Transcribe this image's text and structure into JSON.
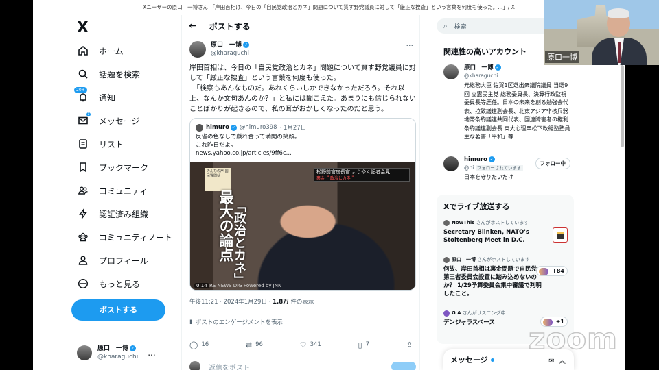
{
  "window": {
    "title": "Xユーザーの原口　一博さん:「岸田首相は、今日の「自民党政治とカネ」問題について質す野党議員に対して「厳正な捜査」という言葉を何度も使った。...」/ X"
  },
  "nav": {
    "logo": "X",
    "items": [
      {
        "label": "ホーム",
        "icon": "home-icon"
      },
      {
        "label": "話題を検索",
        "icon": "search-icon"
      },
      {
        "label": "通知",
        "icon": "bell-icon",
        "badge": "20+"
      },
      {
        "label": "メッセージ",
        "icon": "envelope-icon",
        "badge": "1"
      },
      {
        "label": "リスト",
        "icon": "list-icon"
      },
      {
        "label": "ブックマーク",
        "icon": "bookmark-icon"
      },
      {
        "label": "コミュニティ",
        "icon": "people-icon"
      },
      {
        "label": "認証済み組織",
        "icon": "lightning-icon"
      },
      {
        "label": "コミュニティノート",
        "icon": "community-notes-icon"
      },
      {
        "label": "プロフィール",
        "icon": "person-icon"
      },
      {
        "label": "もっと見る",
        "icon": "more-circle-icon"
      }
    ],
    "post_button": "ポストする",
    "account": {
      "name": "原口　一博",
      "handle": "@kharaguchi",
      "more": "..."
    }
  },
  "main": {
    "header": {
      "back": "←",
      "title": "ポストする"
    },
    "post": {
      "author_name": "原口　一博",
      "author_handle": "@kharaguchi",
      "more": "···",
      "text_lines": [
        "岸田首相は、今日の「自民党政治とカネ」問題について質す野党議員に対",
        "して「厳正な捜査」という言葉を何度も使った。",
        "　「検察もあんなものだ。あれくらいしかできなかっただろう。それ以",
        "上、なんか文句あんのか？」と私には聞こえた。あまりにも信じられない",
        "ことばかりが起きるので、私の耳がおかしくなったのだと思う。"
      ],
      "quote": {
        "name": "himuro",
        "handle": "@himuro398",
        "date": "· 1月27日",
        "lines": [
          "反省の色なしで戯れ合って満開の笑顔。",
          "これ昨日だよ。",
          "news.yahoo.co.jp/articles/9ff6c..."
        ],
        "video": {
          "banner": "みんなの声 国民質問状",
          "title_big": "最大の論点",
          "title_small": "「政治とカネ」",
          "newsbox_main": "松野前官房長官 ようやく記者会見",
          "newsbox_sub": "裏金 ＂政治とカネ＂",
          "caption": "RS NEWS DIG Powered by JNN",
          "duration": "0:14"
        }
      },
      "time": "午後11:21 · 2024年1月29日 · ",
      "views_count": "1.8万",
      "views_label": " 件の表示",
      "engagement": "ポストのエンゲージメントを表示",
      "actions": {
        "reply": "16",
        "repost": "96",
        "like": "341",
        "bookmark": "7"
      }
    },
    "reply_placeholder": "返信をポスト"
  },
  "right": {
    "search_placeholder": "検索",
    "related": {
      "title": "関連性の高いアカウント",
      "accounts": [
        {
          "name": "原口　一博",
          "handle": "@kharaguchi",
          "bio": "元総務大臣 佐賀1区選出衆議院議員 当選9回 立憲民主党 総務委員長、決算行政監視委員長等歴任。日本の未来を創る勉強会代表、拉致議連副会長、北東アジア非核兵器地帯条約議連共同代表、国連障害者の権利条約議連副会長 東大心理卒松下政経塾塾員　主な著書「平和」等"
        },
        {
          "name": "himuro",
          "handle": "@hi",
          "follows_you": "フォローされています",
          "follow_button": "フォロー中",
          "bio": "日本を守りたいだけ"
        }
      ]
    },
    "live": {
      "title": "Xでライブ放送する",
      "items": [
        {
          "host": "NowThis",
          "host_suffix": "さんがホストしています",
          "title": "Secretary Blinken, NATO's Stoltenberg Meet in D.C."
        },
        {
          "host": "原口　一博",
          "host_suffix": "さんがホストしています",
          "title": "何故、岸田首相は裏金問題で自民党の第三者委員会設置に踏み込めないのか？ 1/29予算委員会集中審議で判明したこと。",
          "count": "+84"
        },
        {
          "host": "G A",
          "host_suffix": "さんがリスニング中",
          "title": "デンジャラスベース",
          "count": "+1"
        }
      ]
    },
    "messages": {
      "title": "メッセージ"
    }
  },
  "webcam": {
    "name_label": "原口一博"
  },
  "overlay": {
    "zoom": "zoom"
  }
}
